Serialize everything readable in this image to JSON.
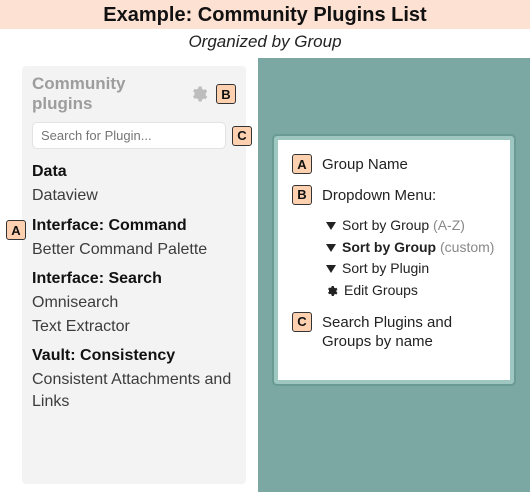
{
  "header": {
    "title": "Example: Community Plugins List",
    "subtitle": "Organized by Group"
  },
  "sidebar": {
    "title": "Community plugins",
    "search_placeholder": "Search for Plugin...",
    "groups": [
      {
        "name": "Data",
        "plugins": [
          "Dataview"
        ]
      },
      {
        "name": "Interface: Command",
        "plugins": [
          "Better Command Palette"
        ]
      },
      {
        "name": "Interface: Search",
        "plugins": [
          "Omnisearch",
          "Text Extractor"
        ]
      },
      {
        "name": "Vault: Consistency",
        "plugins": [
          "Consistent Attachments and Links"
        ]
      }
    ]
  },
  "badges": {
    "a": "A",
    "b": "B",
    "c": "C"
  },
  "legend": {
    "a": "Group Name",
    "b_title": "Dropdown Menu:",
    "b_items": {
      "i1a": "Sort by Group ",
      "i1b": "(A-Z)",
      "i2a": "Sort by Group ",
      "i2b": "(custom)",
      "i3": "Sort by Plugin",
      "i4": "Edit Groups"
    },
    "c": "Search Plugins and Groups by name"
  }
}
